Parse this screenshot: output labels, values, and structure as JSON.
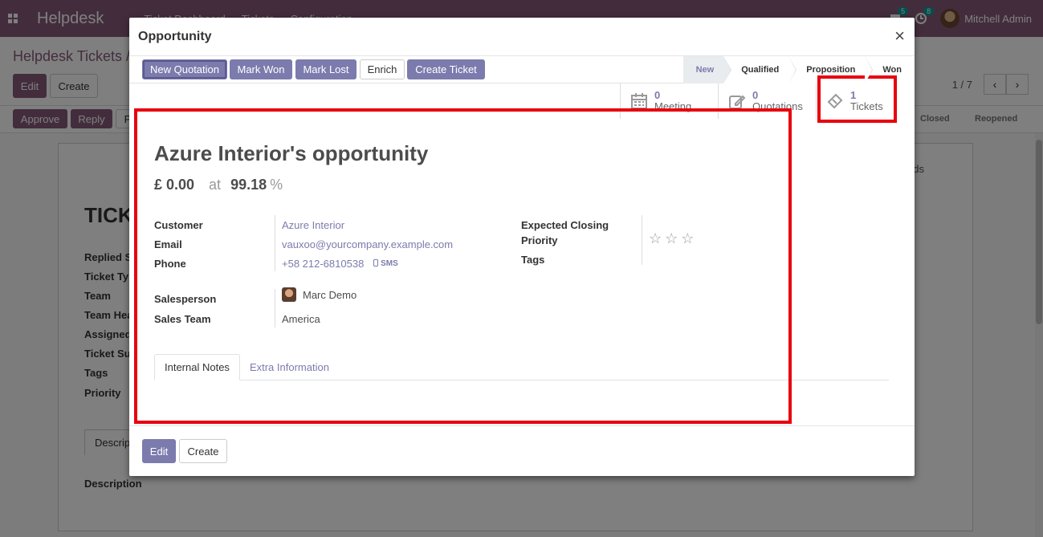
{
  "app": {
    "brand": "Helpdesk",
    "top_menu": [
      "Ticket Dashboard",
      "Tickets",
      "Configuration"
    ],
    "messages_count": "5",
    "activities_count": "8",
    "user_name": "Mitchell Admin"
  },
  "background": {
    "breadcrumb": "Helpdesk Tickets / ",
    "edit_label": "Edit",
    "create_label": "Create",
    "pager": "1 / 7",
    "approve_label": "Approve",
    "reply_label": "Reply",
    "third_label": "P",
    "stages": [
      "Closed",
      "Reopened"
    ],
    "sheet_title": "TICK",
    "fields_link": "ds",
    "labels": [
      "Replied S",
      "Ticket Ty",
      "Team",
      "Team Hea",
      "Assigned",
      "Ticket Su",
      "Tags",
      "Priority"
    ],
    "desc_tab": "Descrip",
    "desc_label": "Description"
  },
  "modal": {
    "title": "Opportunity",
    "close_glyph": "×",
    "actions": {
      "new_quotation": "New Quotation",
      "mark_won": "Mark Won",
      "mark_lost": "Mark Lost",
      "enrich": "Enrich",
      "create_ticket": "Create Ticket"
    },
    "stages": [
      "New",
      "Qualified",
      "Proposition",
      "Won"
    ],
    "current_stage": "New",
    "smart_buttons": {
      "meeting": {
        "count": "0",
        "label": "Meeting"
      },
      "quotations": {
        "count": "0",
        "label": "Quotations"
      },
      "tickets": {
        "count": "1",
        "label": "Tickets"
      }
    },
    "opportunity_name": "Azure Interior's opportunity",
    "revenue": "£ 0.00",
    "at_label": "at",
    "probability": "99.18",
    "percent_sign": "%",
    "fields": {
      "customer_label": "Customer",
      "customer": "Azure Interior",
      "email_label": "Email",
      "email": "vauxoo@yourcompany.example.com",
      "phone_label": "Phone",
      "phone": "+58 212-6810538",
      "sms_label": "SMS",
      "expected_closing_label": "Expected Closing",
      "priority_label": "Priority",
      "tags_label": "Tags",
      "priority_stars": 0,
      "salesperson_label": "Salesperson",
      "salesperson": "Marc Demo",
      "sales_team_label": "Sales Team",
      "sales_team": "America"
    },
    "tabs": [
      "Internal Notes",
      "Extra Information"
    ],
    "footer": {
      "edit_label": "Edit",
      "create_label": "Create"
    }
  },
  "colors": {
    "brand": "#875a7b",
    "accent": "#7c7bad",
    "highlight": "#e8000e"
  }
}
